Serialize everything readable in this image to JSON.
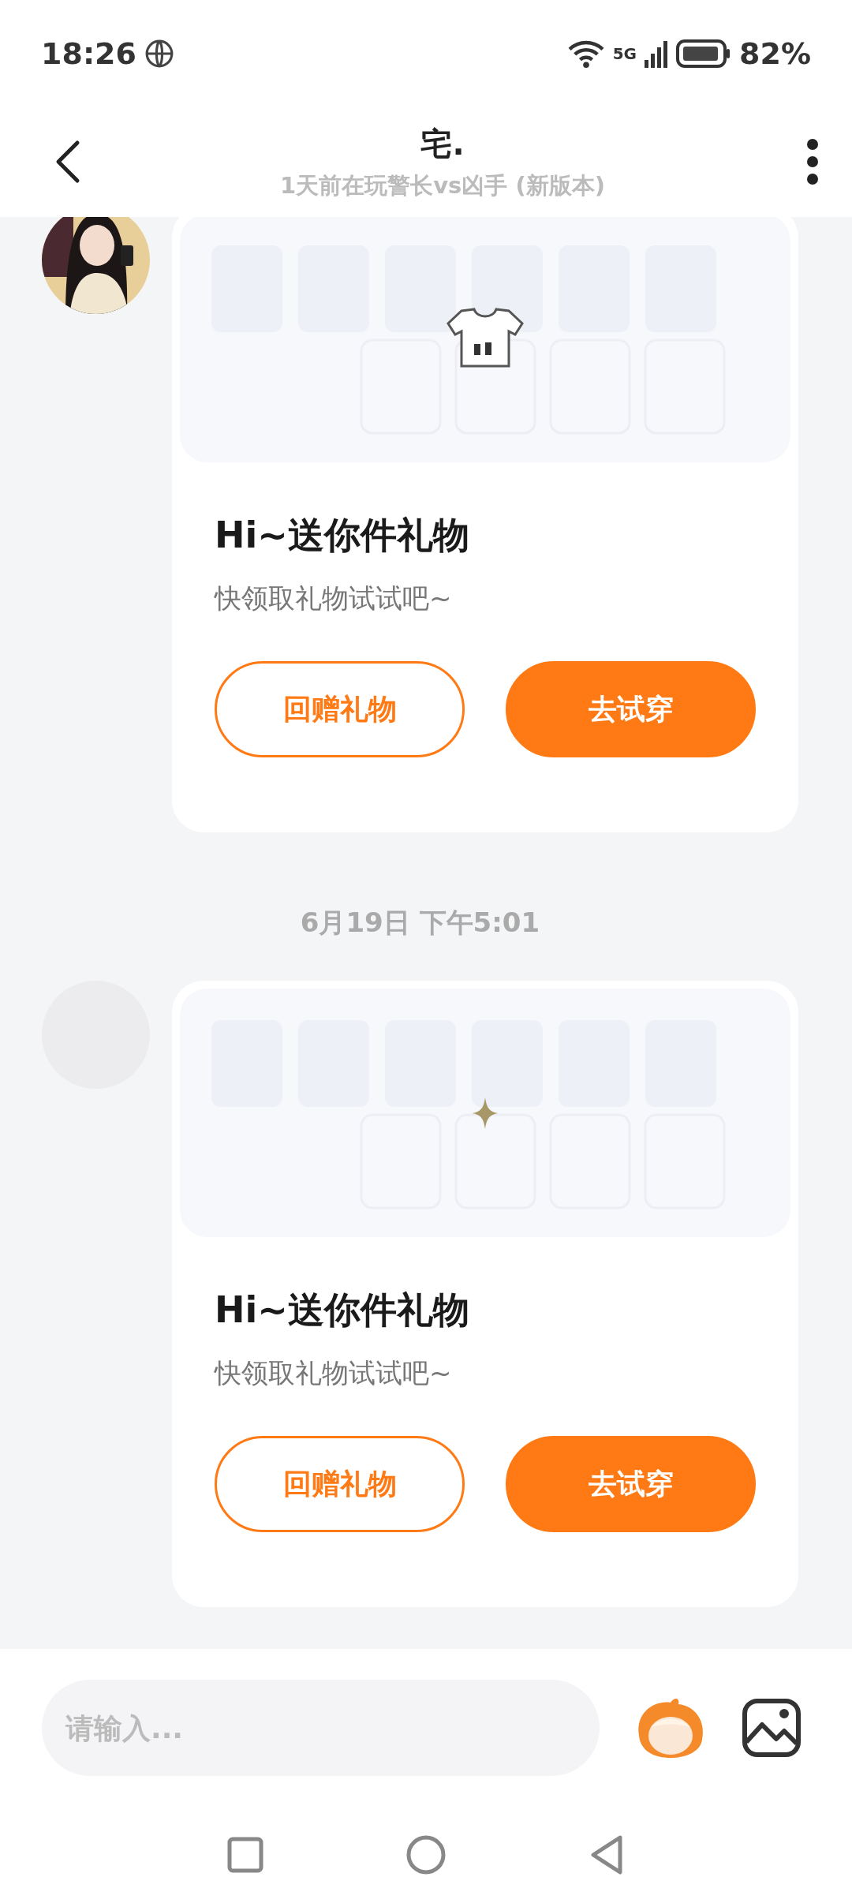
{
  "status_bar": {
    "time": "18:26",
    "network": "5G",
    "battery": "82%"
  },
  "header": {
    "title": "宅.",
    "subtitle": "1天前在玩警长vs凶手 (新版本)"
  },
  "messages": [
    {
      "kind": "gift",
      "avatar": {
        "kind": "picture"
      },
      "banner": {
        "kind": "picture"
      },
      "item": {
        "kind": "shirt"
      },
      "title": "Hi~送你件礼物",
      "text": "快领取礼物试试吧~",
      "buttons": [
        {
          "kind": "outline",
          "label": "回赠礼物"
        },
        {
          "kind": "filled",
          "label": "去试穿"
        }
      ]
    },
    {
      "kind": "timestamp",
      "text": "6月19日 下午5:01"
    },
    {
      "kind": "gift",
      "avatar": {
        "kind": "placeholder"
      },
      "banner": {
        "kind": "picture"
      },
      "item": {
        "kind": "sparkle"
      },
      "title": "Hi~送你件礼物",
      "text": "快领取礼物试试吧~",
      "buttons": [
        {
          "kind": "outline",
          "label": "回赠礼物"
        },
        {
          "kind": "filled",
          "label": "去试穿"
        }
      ]
    }
  ],
  "input": {
    "placeholder": "请输入..."
  }
}
